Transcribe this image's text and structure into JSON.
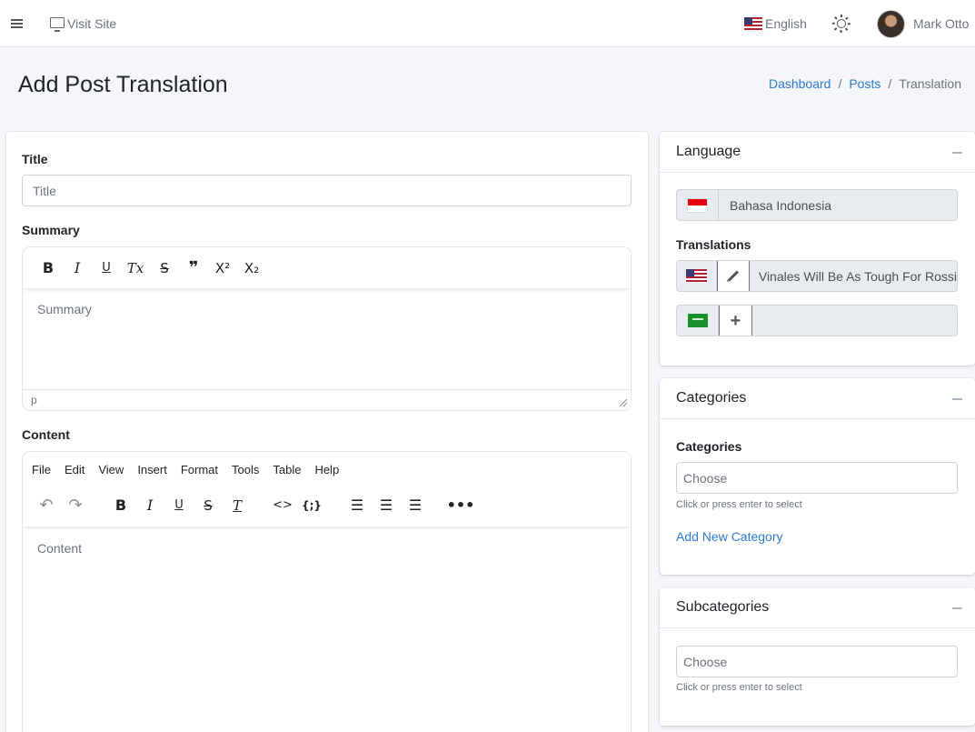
{
  "navbar": {
    "visit_site": "Visit Site",
    "language": "English",
    "user_name": "Mark Otto"
  },
  "header": {
    "title": "Add Post Translation",
    "breadcrumb": [
      "Dashboard",
      "Posts",
      "Translation"
    ]
  },
  "form": {
    "title_label": "Title",
    "title_placeholder": "Title",
    "summary_label": "Summary",
    "summary_placeholder": "Summary",
    "summary_status_path": "p",
    "content_label": "Content",
    "content_placeholder": "Content",
    "summary_toolbar": [
      "B",
      "I",
      "U",
      "Tx",
      "S",
      "❞",
      "X²",
      "X₂"
    ],
    "content_menu": [
      "File",
      "Edit",
      "View",
      "Insert",
      "Format",
      "Tools",
      "Table",
      "Help"
    ]
  },
  "language_card": {
    "title": "Language",
    "current_language": "Bahasa Indonesia",
    "translations_label": "Translations",
    "translations": [
      {
        "flag": "us-flag",
        "action": "pencil-icon",
        "value": "Vinales Will Be As Tough For Rossi"
      },
      {
        "flag": "sa-flag",
        "action": "plus-icon",
        "value": ""
      }
    ]
  },
  "categories_card": {
    "title": "Categories",
    "field_label": "Categories",
    "placeholder": "Choose",
    "help": "Click or press enter to select",
    "add_link": "Add New Category"
  },
  "subcategories_card": {
    "title": "Subcategories",
    "placeholder": "Choose",
    "help": "Click or press enter to select"
  }
}
